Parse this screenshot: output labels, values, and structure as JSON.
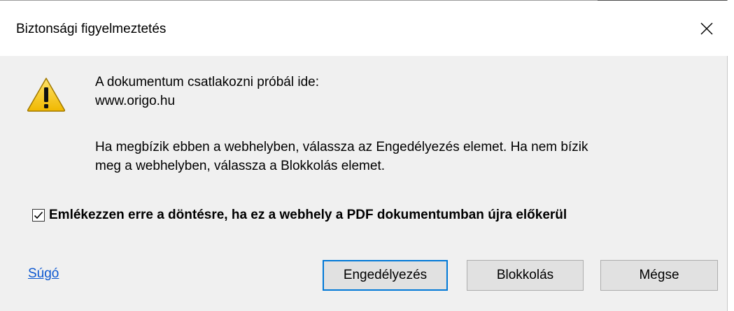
{
  "dialog": {
    "title": "Biztonsági figyelmeztetés",
    "close_glyph": "✕",
    "warning_icon": "warning-triangle-icon"
  },
  "message": {
    "line1": "A dokumentum csatlakozni próbál ide:",
    "url": "www.origo.hu",
    "body_line1": "Ha megbízik ebben a webhelyben, válassza az Engedélyezés elemet. Ha nem bízik",
    "body_line2": "meg a webhelyben, válassza a Blokkolás elemet."
  },
  "remember": {
    "checked": true,
    "label": "Emlékezzen erre a döntésre, ha ez a webhely a PDF dokumentumban újra előkerül"
  },
  "footer": {
    "help_link": "Súgó",
    "allow_button": "Engedélyezés",
    "block_button": "Blokkolás",
    "cancel_button": "Mégse"
  },
  "colors": {
    "accent": "#0078d7",
    "link": "#0b57d0",
    "warning_yellow": "#f2c40f",
    "dialog_bg": "#f0f0f0"
  }
}
